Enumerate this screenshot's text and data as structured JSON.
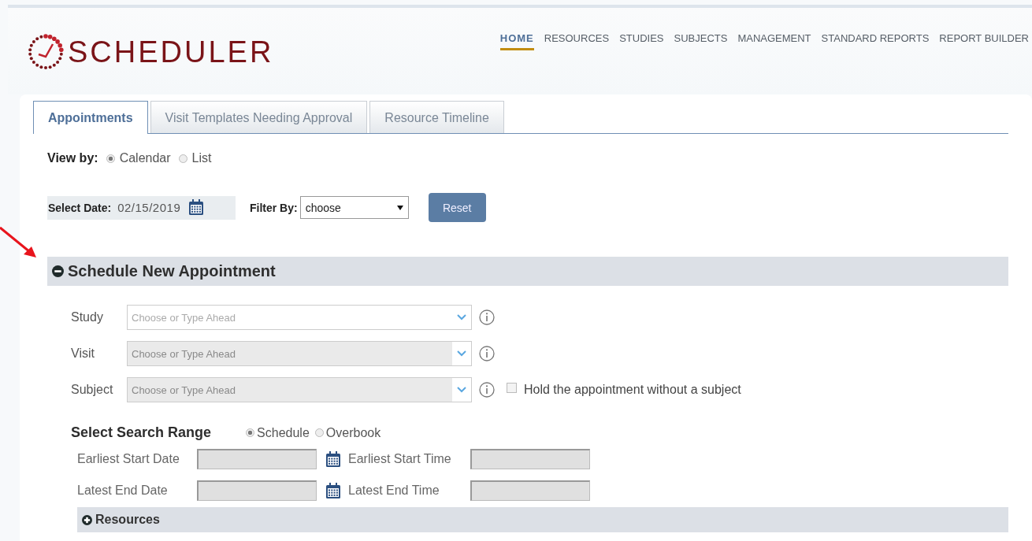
{
  "logo": {
    "text": "SCHEDULER"
  },
  "nav": [
    {
      "label": "HOME",
      "selected": true
    },
    {
      "label": "RESOURCES",
      "selected": false
    },
    {
      "label": "STUDIES",
      "selected": false
    },
    {
      "label": "SUBJECTS",
      "selected": false
    },
    {
      "label": "MANAGEMENT",
      "selected": false
    },
    {
      "label": "STANDARD REPORTS",
      "selected": false
    },
    {
      "label": "REPORT BUILDER",
      "selected": false
    }
  ],
  "tabs": [
    {
      "label": "Appointments",
      "selected": true
    },
    {
      "label": "Visit Templates Needing Approval",
      "selected": false
    },
    {
      "label": "Resource Timeline",
      "selected": false
    }
  ],
  "view_by": {
    "label": "View by:",
    "options": [
      {
        "label": "Calendar",
        "selected": true
      },
      {
        "label": "List",
        "selected": false
      }
    ]
  },
  "select_date": {
    "label": "Select Date:",
    "value": "02/15/2019"
  },
  "filter_by": {
    "label": "Filter By:",
    "value": "choose"
  },
  "reset_button": "Reset",
  "schedule_section": {
    "title": "Schedule New Appointment",
    "expanded": true,
    "fields": [
      {
        "label": "Study",
        "placeholder": "Choose or Type Ahead",
        "disabled": false
      },
      {
        "label": "Visit",
        "placeholder": "Choose or Type Ahead",
        "disabled": true
      },
      {
        "label": "Subject",
        "placeholder": "Choose or Type Ahead",
        "disabled": true,
        "checkbox": {
          "label": "Hold the appointment without a subject",
          "checked": false
        }
      }
    ],
    "search_range": {
      "title": "Select Search Range",
      "options": [
        {
          "label": "Schedule",
          "selected": true
        },
        {
          "label": "Overbook",
          "selected": false
        }
      ],
      "fields": [
        {
          "label": "Earliest Start Date",
          "kind": "date"
        },
        {
          "label": "Earliest Start Time",
          "kind": "time"
        },
        {
          "label": "Latest End Date",
          "kind": "date"
        },
        {
          "label": "Latest End Time",
          "kind": "time"
        }
      ]
    },
    "resources": {
      "title": "Resources",
      "expanded": false
    }
  }
}
